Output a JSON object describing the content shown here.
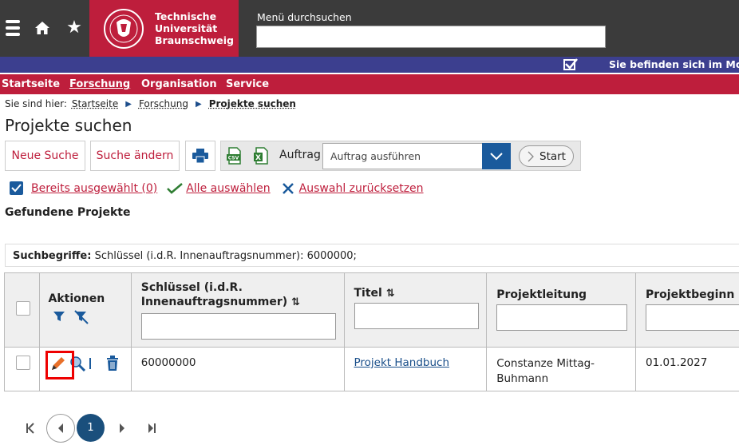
{
  "header": {
    "logo_lines": [
      "Technische",
      "Universität",
      "Braunschweig"
    ],
    "search_label": "Menü durchsuchen",
    "search_value": ""
  },
  "module_bar": {
    "text": "Sie befinden sich im Modu"
  },
  "nav": {
    "items": [
      {
        "label": "Startseite",
        "active": false
      },
      {
        "label": "Forschung",
        "active": true
      },
      {
        "label": "Organisation",
        "active": false
      },
      {
        "label": "Service",
        "active": false
      }
    ]
  },
  "breadcrumb": {
    "prefix": "Sie sind hier:",
    "items": [
      "Startseite",
      "Forschung",
      "Projekte suchen"
    ]
  },
  "page_title": "Projekte suchen",
  "toolbar": {
    "neue_suche": "Neue Suche",
    "suche_aendern": "Suche ändern",
    "auftrag_label": "Auftrag",
    "auftrag_value": "Auftrag ausführen",
    "start_label": "Start"
  },
  "selection": {
    "bereits": "Bereits ausgewählt (0)",
    "alle": "Alle auswählen",
    "reset": "Auswahl zurücksetzen"
  },
  "section_title": "Gefundene Projekte",
  "suchbegriffe": {
    "label": "Suchbegriffe:",
    "value": "Schlüssel (i.d.R. Innenauftragsnummer): 6000000;"
  },
  "table": {
    "headers": {
      "aktionen": "Aktionen",
      "schluessel_1": "Schlüssel (i.d.R.",
      "schluessel_2": "Innenauftragsnummer)",
      "titel": "Titel",
      "projektleitung": "Projektleitung",
      "projektbeginn": "Projektbeginn"
    },
    "rows": [
      {
        "schluessel": "60000000",
        "titel": "Projekt Handbuch",
        "projektleitung_1": "Constanze Mittag-",
        "projektleitung_2": "Buhmann",
        "projektbeginn": "01.01.2027"
      }
    ]
  },
  "pagination": {
    "current_page": "1"
  },
  "colors": {
    "tu_red": "#be1e3c",
    "dark_header": "#3b3b3b",
    "module_blue": "#3c3f8f",
    "accent_blue": "#1a5a9c"
  }
}
